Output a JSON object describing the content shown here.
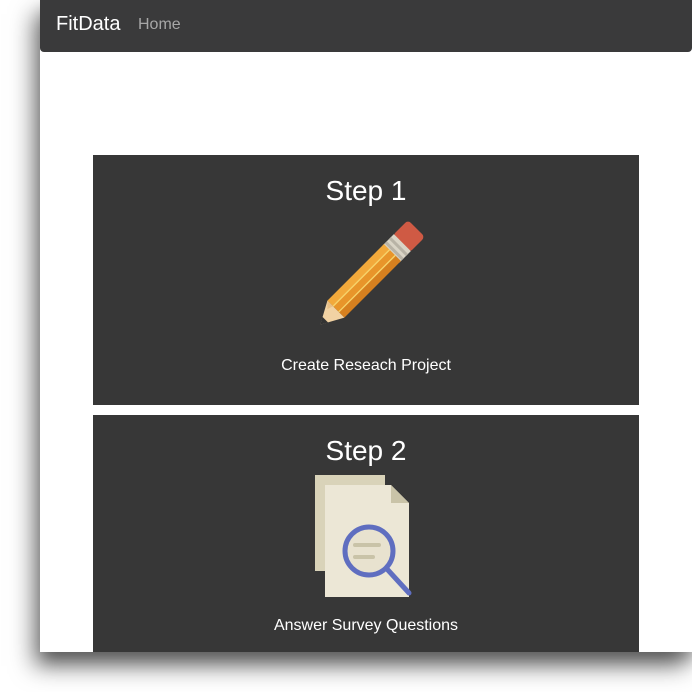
{
  "navbar": {
    "brand": "FitData",
    "home_link": "Home"
  },
  "steps": [
    {
      "title": "Step 1",
      "caption": "Create Reseach Project",
      "icon": "pencil-icon"
    },
    {
      "title": "Step 2",
      "caption": "Answer Survey Questions",
      "icon": "document-search-icon"
    }
  ],
  "colors": {
    "navbar_bg": "#3a3a3b",
    "card_bg": "#373737",
    "brand_text": "#ffffff",
    "nav_link_text": "#a7a7a7"
  }
}
